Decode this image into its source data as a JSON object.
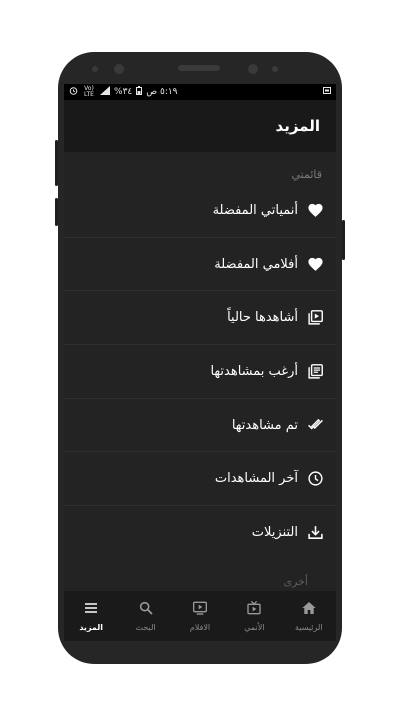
{
  "status_bar": {
    "time": "٥:١٩ ص",
    "battery": "٣٤%",
    "network": "Vo) LTE"
  },
  "app_bar": {
    "title": "المزيد"
  },
  "my_list": {
    "section_label": "قائمتي",
    "items": [
      {
        "label": "أنمياتي المفضلة",
        "icon": "heart-icon"
      },
      {
        "label": "أفلامي المفضلة",
        "icon": "heart-icon"
      },
      {
        "label": "أشاهدها حالياً",
        "icon": "play-library-icon"
      },
      {
        "label": "أرغب بمشاهدتها",
        "icon": "list-library-icon"
      },
      {
        "label": "تم مشاهدتها",
        "icon": "double-check-icon"
      },
      {
        "label": "آخر المشاهدات",
        "icon": "clock-icon"
      },
      {
        "label": "التنزيلات",
        "icon": "download-icon"
      }
    ]
  },
  "other_section_label": "أخرى",
  "bottom_nav": {
    "items": [
      {
        "label": "الرئيسية",
        "icon": "home-icon",
        "active": false
      },
      {
        "label": "الأنمي",
        "icon": "tv-icon",
        "active": false
      },
      {
        "label": "الافلام",
        "icon": "movie-icon",
        "active": false
      },
      {
        "label": "البحث",
        "icon": "search-icon",
        "active": false
      },
      {
        "label": "المزيد",
        "icon": "menu-icon",
        "active": true
      }
    ]
  },
  "colors": {
    "background": "#232323",
    "app_bar": "#191919",
    "text": "#ffffff",
    "muted_text": "#7b7b7b",
    "bottom_nav": "#1a1a1a"
  }
}
